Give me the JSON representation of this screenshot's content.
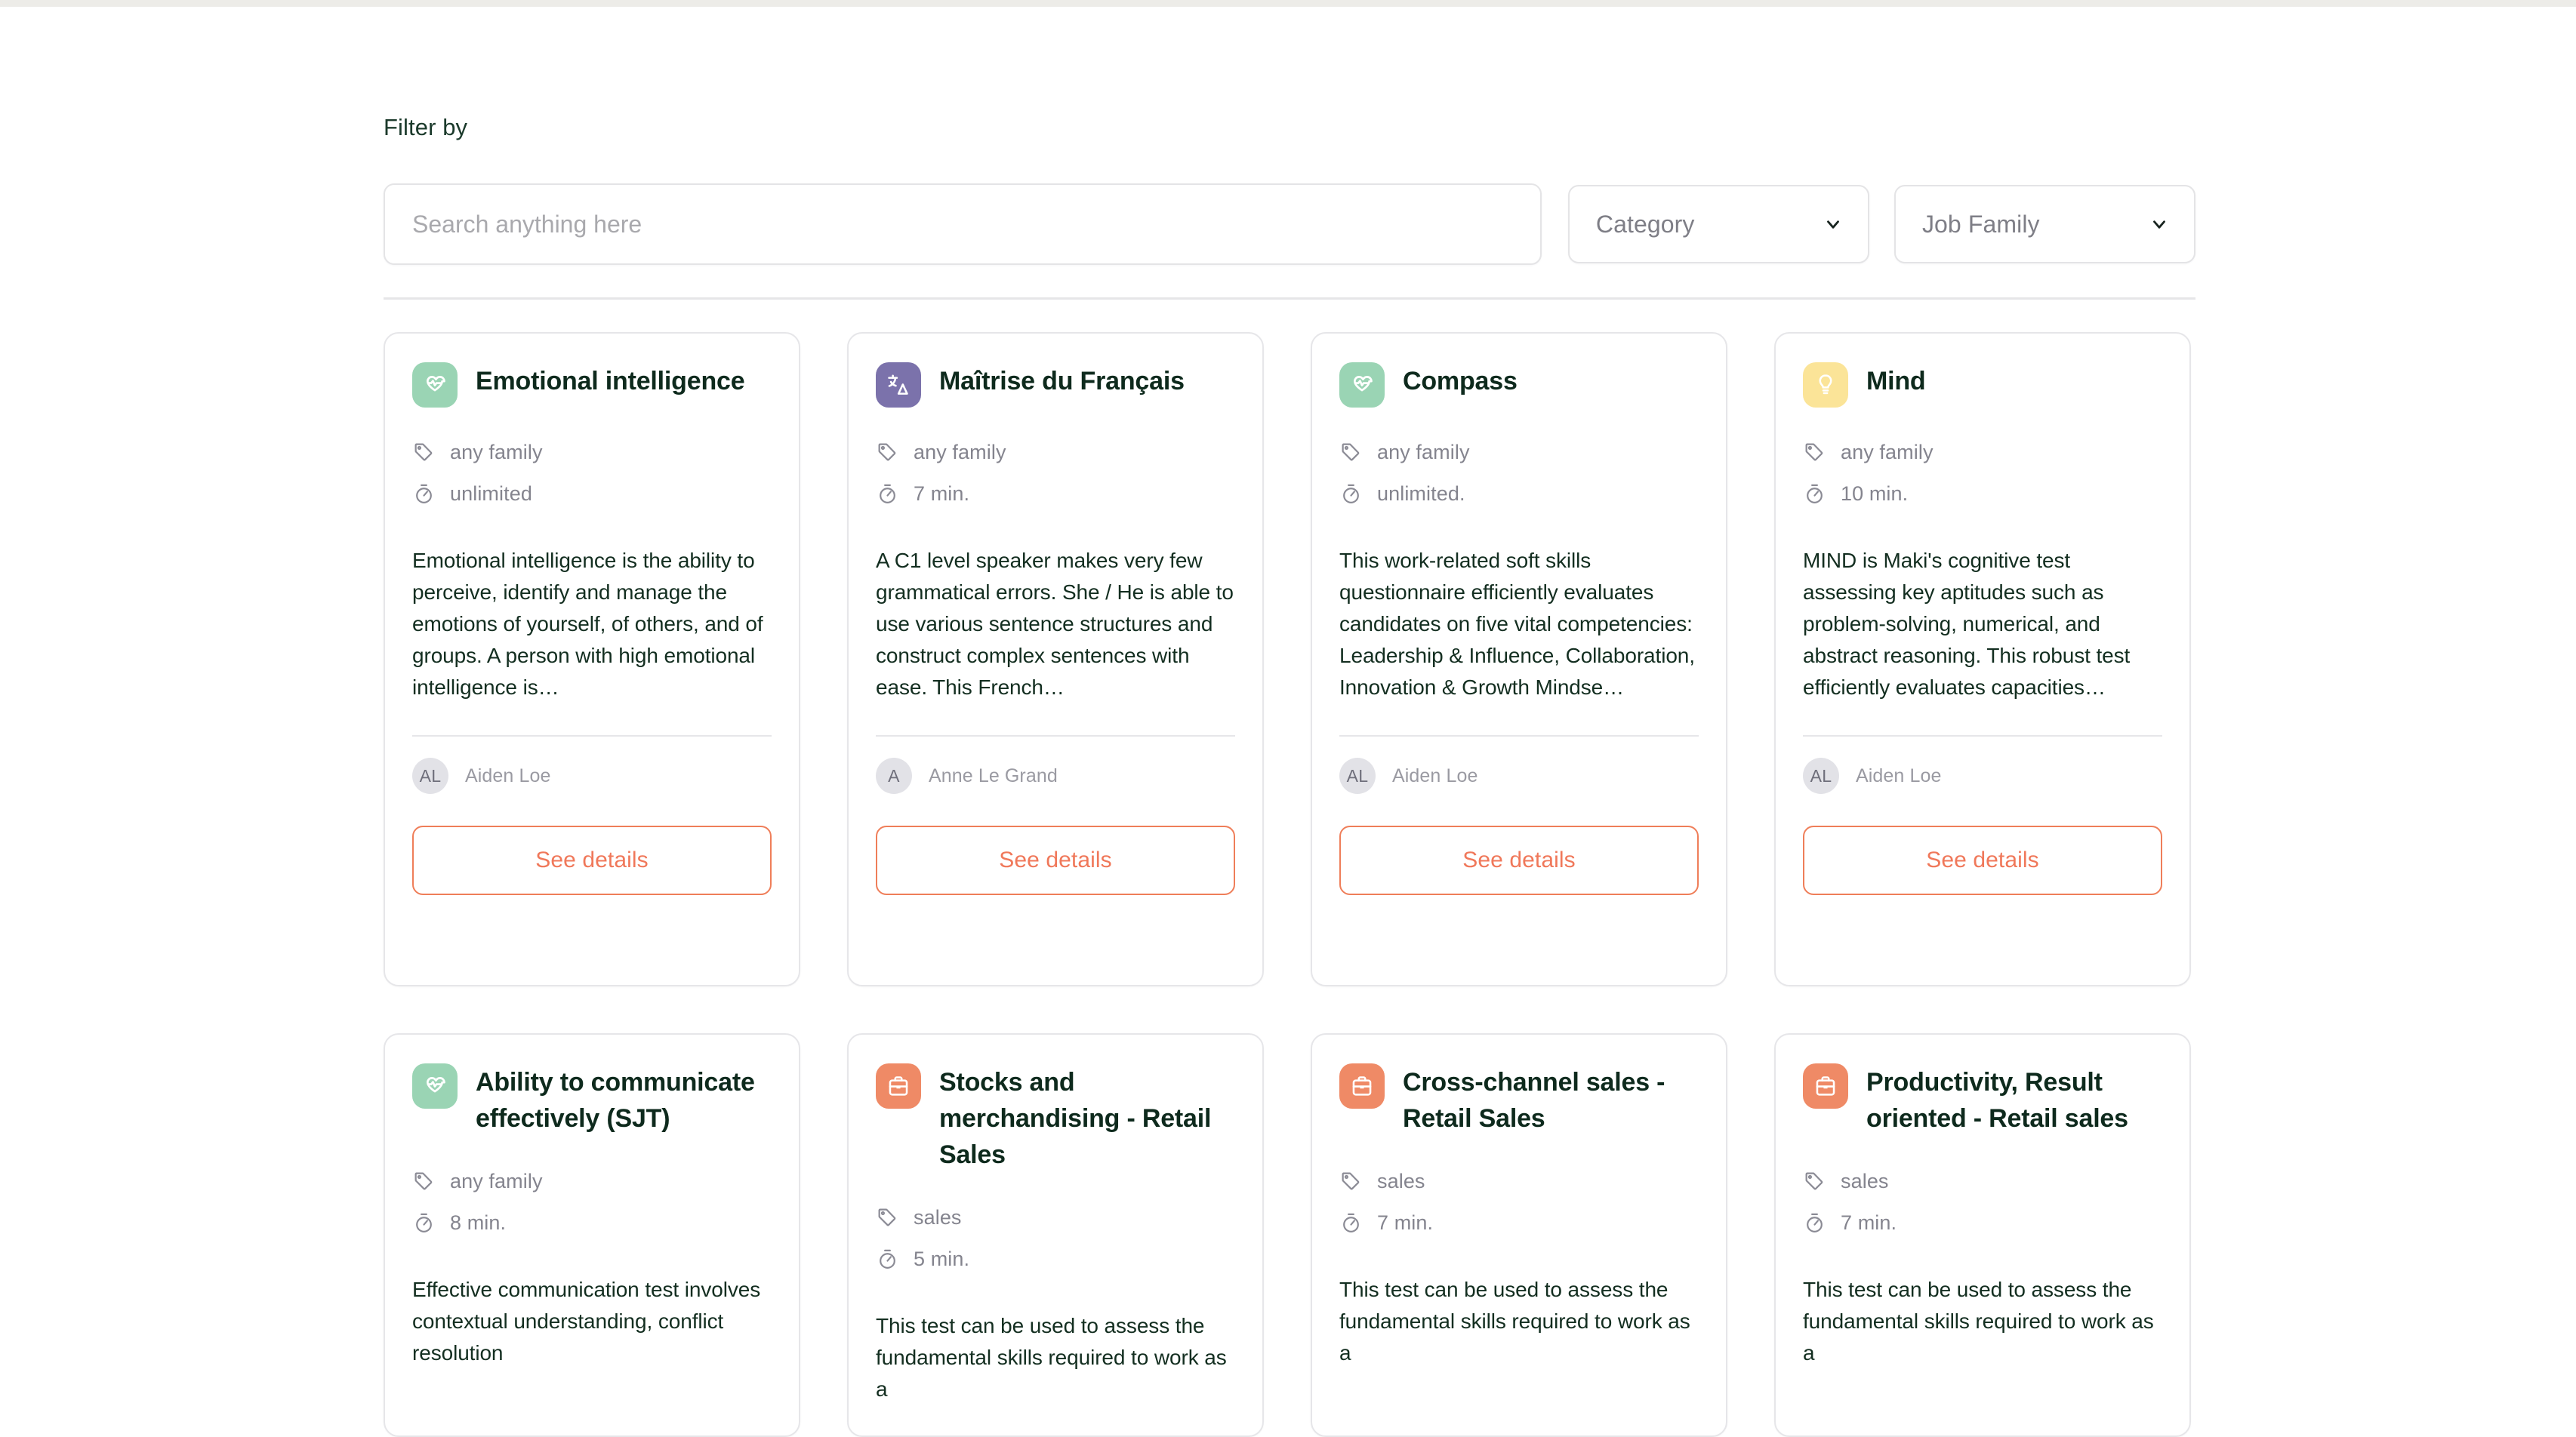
{
  "filters": {
    "label": "Filter by",
    "search": {
      "value": "",
      "placeholder": "Search anything here"
    },
    "category": {
      "label": "Category",
      "icon": "chevron-down-icon"
    },
    "job_family": {
      "label": "Job Family",
      "icon": "chevron-down-icon"
    }
  },
  "card_action_label": "See details",
  "cards": [
    {
      "title": "Emotional intelligence",
      "icon": "heart-pulse-icon",
      "icon_bg": "#9ad4b4",
      "family": "any family",
      "duration": "unlimited",
      "description": "Emotional intelligence is the ability to perceive, identify and manage the emotions of yourself, of others, and of groups. A person with high emotional intelligence is…",
      "author": "Aiden Loe",
      "author_initials": "AL",
      "action": "See details"
    },
    {
      "title": "Maîtrise du Français",
      "icon": "translate-icon",
      "icon_bg": "#7b72ab",
      "family": "any family",
      "duration": "7 min.",
      "description": "A C1 level speaker makes very few grammatical errors. She / He is able to use various sentence structures and construct complex sentences with ease. This French…",
      "author": "Anne Le Grand",
      "author_initials": "A",
      "action": "See details"
    },
    {
      "title": "Compass",
      "icon": "heart-pulse-icon",
      "icon_bg": "#9ad4b4",
      "family": "any family",
      "duration": "unlimited.",
      "description": "This work-related soft skills questionnaire efficiently evaluates candidates on five vital competencies: Leadership & Influence, Collaboration, Innovation & Growth Mindse…",
      "author": "Aiden Loe",
      "author_initials": "AL",
      "action": "See details"
    },
    {
      "title": "Mind",
      "icon": "lightbulb-icon",
      "icon_bg": "#fbe498",
      "family": "any family",
      "duration": "10 min.",
      "description": "MIND is Maki's cognitive test assessing key aptitudes such as problem-solving, numerical, and abstract reasoning. This robust test efficiently evaluates capacities…",
      "author": "Aiden Loe",
      "author_initials": "AL",
      "action": "See details"
    },
    {
      "title": "Ability to communicate effectively (SJT)",
      "icon": "heart-pulse-icon",
      "icon_bg": "#9ad4b4",
      "family": "any family",
      "duration": "8 min.",
      "description": "Effective communication test involves contextual understanding, conflict resolution"
    },
    {
      "title": "Stocks and merchandising - Retail Sales",
      "icon": "briefcase-icon",
      "icon_bg": "#ef8a66",
      "family": "sales",
      "duration": "5 min.",
      "description": "This test can be used to assess the fundamental skills required to work as a"
    },
    {
      "title": "Cross-channel sales - Retail Sales",
      "icon": "briefcase-icon",
      "icon_bg": "#ef8a66",
      "family": "sales",
      "duration": "7 min.",
      "description": "This test can be used to assess the fundamental skills required to work as a"
    },
    {
      "title": "Productivity, Result oriented - Retail sales",
      "icon": "briefcase-icon",
      "icon_bg": "#ef8a66",
      "family": "sales",
      "duration": "7 min.",
      "description": "This test can be used to assess the fundamental skills required to work as a"
    }
  ],
  "colors": {
    "accent": "#f0785a",
    "border": "#e6e6e9",
    "muted_text": "#84848e",
    "title_text": "#0e2a1d"
  }
}
